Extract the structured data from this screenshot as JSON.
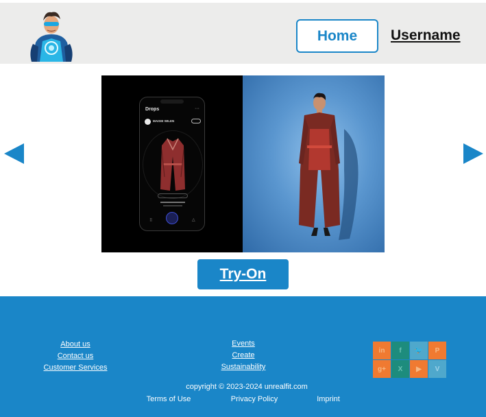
{
  "header": {
    "home_label": "Home",
    "username_label": "Username"
  },
  "phone": {
    "title": "Drops",
    "dots": "···",
    "brand": "MAISIE WILEN"
  },
  "main": {
    "try_on_label": "Try-On"
  },
  "footer": {
    "col1": [
      "About us",
      "Contact us",
      "Customer Services"
    ],
    "col2": [
      "Events",
      "Create",
      "Sustainability"
    ],
    "copyright": "copyright © 2023-2024 unrealfit.com",
    "legal": [
      "Terms of Use",
      "Privacy Policy",
      "Imprint"
    ],
    "social": [
      {
        "icon": "linkedin-icon",
        "glyph": "in",
        "bg": "#f07a31",
        "fg": "#f6b884"
      },
      {
        "icon": "facebook-icon",
        "glyph": "f",
        "bg": "#1d8c7d",
        "fg": "#6bc2b4"
      },
      {
        "icon": "twitter-icon",
        "glyph": "🐦",
        "bg": "#4fa8cc",
        "fg": "#9fd3ea"
      },
      {
        "icon": "pinterest-icon",
        "glyph": "P",
        "bg": "#f07a31",
        "fg": "#f6b884"
      },
      {
        "icon": "google-plus-icon",
        "glyph": "g+",
        "bg": "#f07a31",
        "fg": "#f6b884"
      },
      {
        "icon": "x-icon",
        "glyph": "X",
        "bg": "#1d8c7d",
        "fg": "#6bc2b4"
      },
      {
        "icon": "youtube-icon",
        "glyph": "▶",
        "bg": "#f07a31",
        "fg": "#f6b884"
      },
      {
        "icon": "vine-icon",
        "glyph": "V",
        "bg": "#4fa8cc",
        "fg": "#9fd3ea"
      }
    ]
  },
  "colors": {
    "accent": "#1a86c8",
    "header_bg": "#ececeb"
  }
}
